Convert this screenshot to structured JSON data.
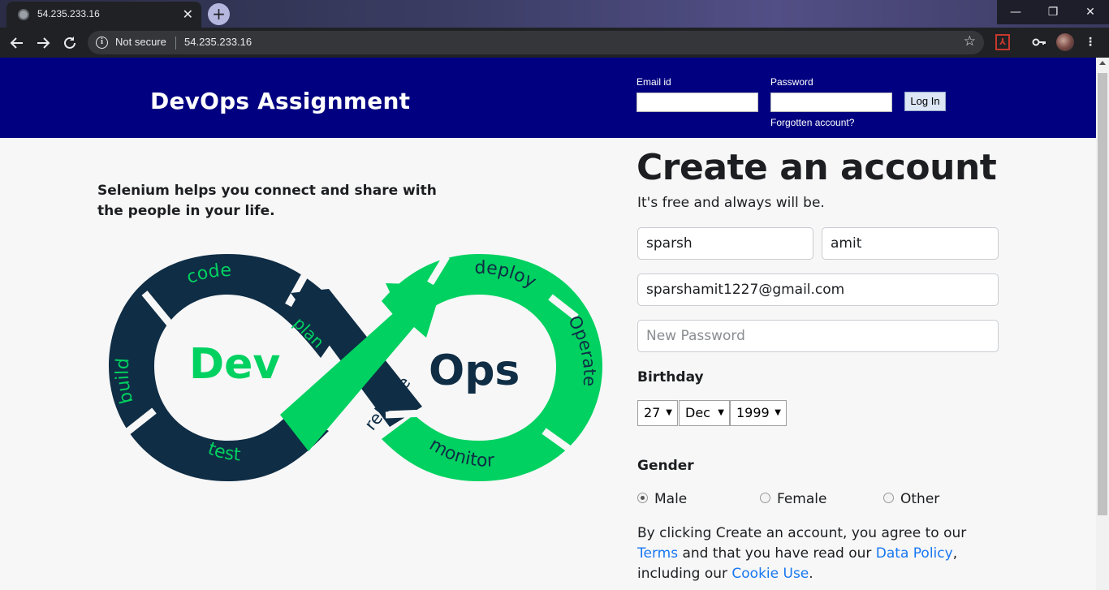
{
  "browser": {
    "tab_title": "54.235.233.16",
    "tab_close": "✕",
    "new_tab": "+",
    "security_label": "Not secure",
    "url": "54.235.233.16",
    "window_min": "—",
    "window_max": "❐",
    "window_close": "✕"
  },
  "header": {
    "brand": "DevOps Assignment",
    "email_label": "Email id",
    "password_label": "Password",
    "login_button": "Log In",
    "forgot_link": "Forgotten account?"
  },
  "left": {
    "tagline": "Selenium helps you connect and share with the people in your life.",
    "logo": {
      "dev": "Dev",
      "ops": "Ops",
      "stages": [
        "code",
        "plan",
        "build",
        "test",
        "release",
        "deploy",
        "Operate",
        "monitor"
      ]
    }
  },
  "signup": {
    "title": "Create an account",
    "subtitle": "It's free and always will be.",
    "first_name": "sparsh",
    "surname": "amit",
    "email": "sparshamit1227@gmail.com",
    "password_placeholder": "New Password",
    "birthday_label": "Birthday",
    "birthday": {
      "day": "27",
      "month": "Dec",
      "year": "1999"
    },
    "gender_label": "Gender",
    "gender_options": [
      "Male",
      "Female",
      "Other"
    ],
    "gender_selected": "Male",
    "terms": {
      "t1": "By clicking Create an account, you agree to our ",
      "terms_link": "Terms",
      "t2": " and that you have read our ",
      "data_policy_link": "Data Policy",
      "t3": ", including our ",
      "cookie_link": "Cookie Use",
      "t4": "."
    }
  },
  "colors": {
    "header_bg": "#010080",
    "logo_dark": "#0f2d45",
    "logo_green": "#00d160",
    "link": "#1877f2"
  }
}
